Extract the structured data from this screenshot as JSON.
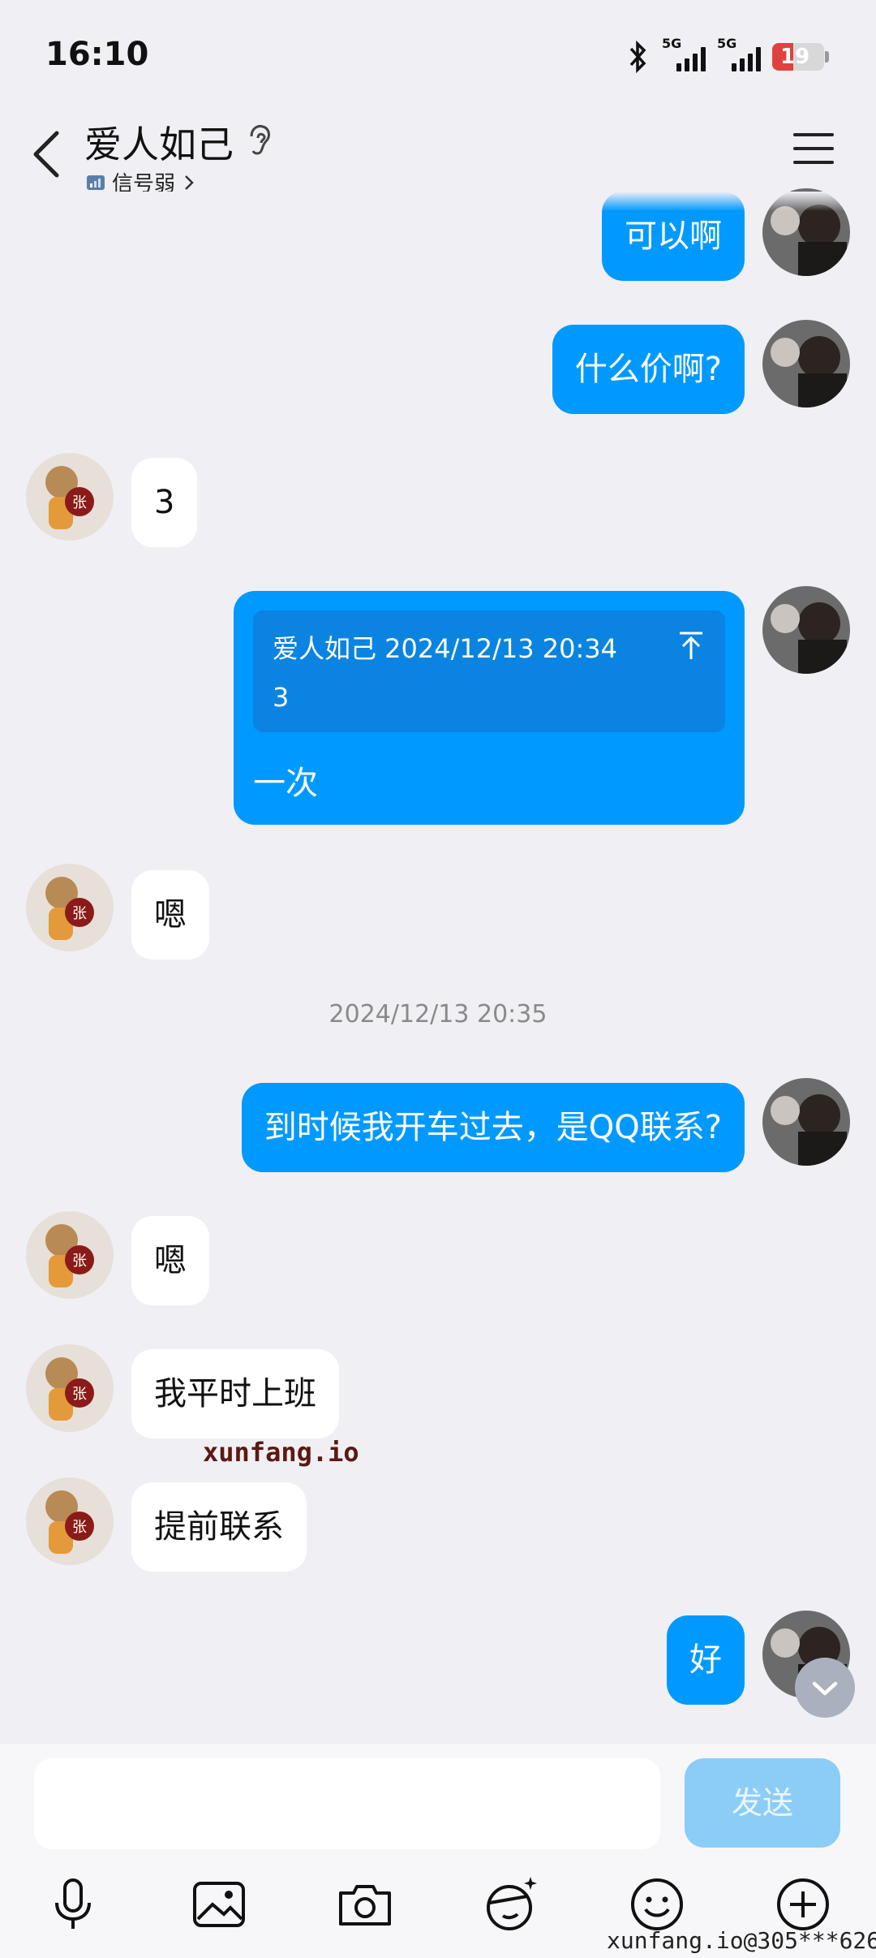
{
  "status_bar": {
    "time": "16:10",
    "battery": "19",
    "net1": "5G",
    "net2": "5G"
  },
  "header": {
    "title": "爱人如己",
    "signal_text": "信号弱"
  },
  "messages": {
    "m1": "可以啊",
    "m2": "什么价啊?",
    "m3": "3",
    "reply_quote_header": "爱人如己 2024/12/13 20:34",
    "reply_quote_body": "3",
    "reply_text": "一次",
    "m5": "嗯",
    "timestamp": "2024/12/13 20:35",
    "m6": "到时候我开车过去，是QQ联系?",
    "m7": "嗯",
    "m8": "我平时上班",
    "m9": "提前联系",
    "m10": "好"
  },
  "input": {
    "send_label": "发送",
    "placeholder": ""
  },
  "watermark": {
    "site": "xunfang.io",
    "footer": "xunfang.io@305***626"
  },
  "colors": {
    "accent": "#0099ff",
    "send_disabled": "#8ccdf7",
    "background": "#f0eff4"
  },
  "icons": [
    "back-icon",
    "ear-icon",
    "menu-icon",
    "microphone-icon",
    "image-icon",
    "camera-icon",
    "face-filter-icon",
    "emoji-icon",
    "plus-icon",
    "chevron-down-icon"
  ]
}
